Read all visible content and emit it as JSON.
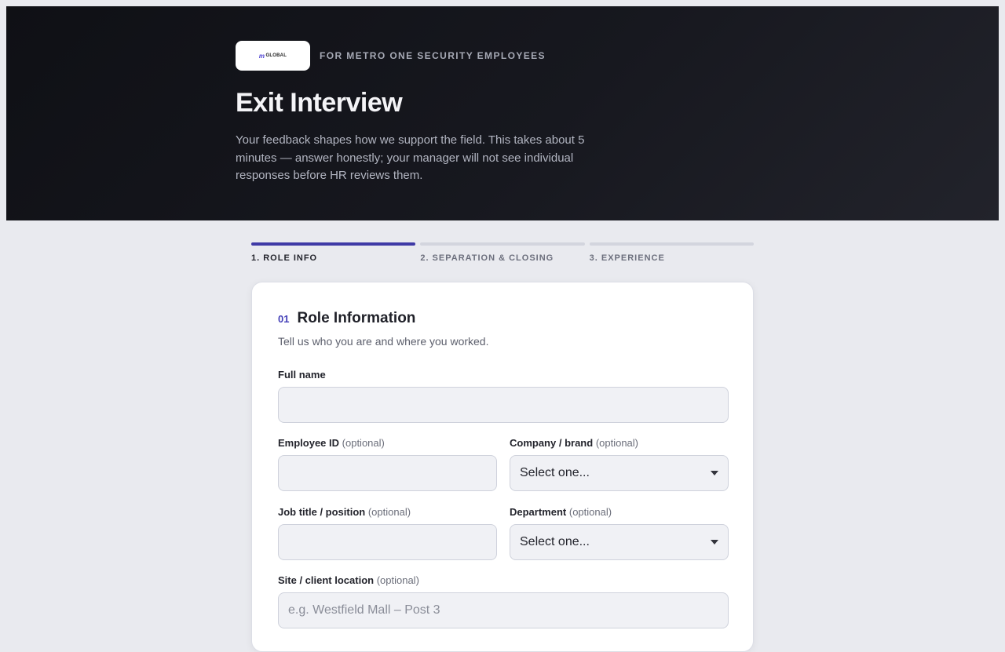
{
  "header": {
    "logo": {
      "mark": "m",
      "text": "GLOBAL"
    },
    "eyebrow": "FOR METRO ONE SECURITY EMPLOYEES",
    "title": "Exit Interview",
    "subtitle": "Your feedback shapes how we support the field. This takes about 5 minutes — answer honestly; your manager will not see individual responses before HR reviews them."
  },
  "steps": [
    {
      "label": "1. ROLE INFO",
      "active": true
    },
    {
      "label": "2. SEPARATION & CLOSING",
      "active": false
    },
    {
      "label": "3. EXPERIENCE",
      "active": false
    }
  ],
  "section": {
    "number": "01",
    "title": "Role Information",
    "subtitle": "Tell us who you are and where you worked."
  },
  "fields": {
    "full_name": {
      "label": "Full name",
      "value": ""
    },
    "employee_id": {
      "label": "Employee ID",
      "optional": "(optional)",
      "value": ""
    },
    "company": {
      "label": "Company / brand",
      "optional": "(optional)",
      "selected": "Select one..."
    },
    "job_title": {
      "label": "Job title / position",
      "optional": "(optional)",
      "value": ""
    },
    "department": {
      "label": "Department",
      "optional": "(optional)",
      "selected": "Select one..."
    },
    "site": {
      "label": "Site / client location",
      "optional": "(optional)",
      "placeholder": "e.g. Westfield Mall – Post 3"
    }
  },
  "colors": {
    "accent": "#3f3aa6",
    "hero_bg": "#111218",
    "page_bg": "#e9eaef"
  }
}
